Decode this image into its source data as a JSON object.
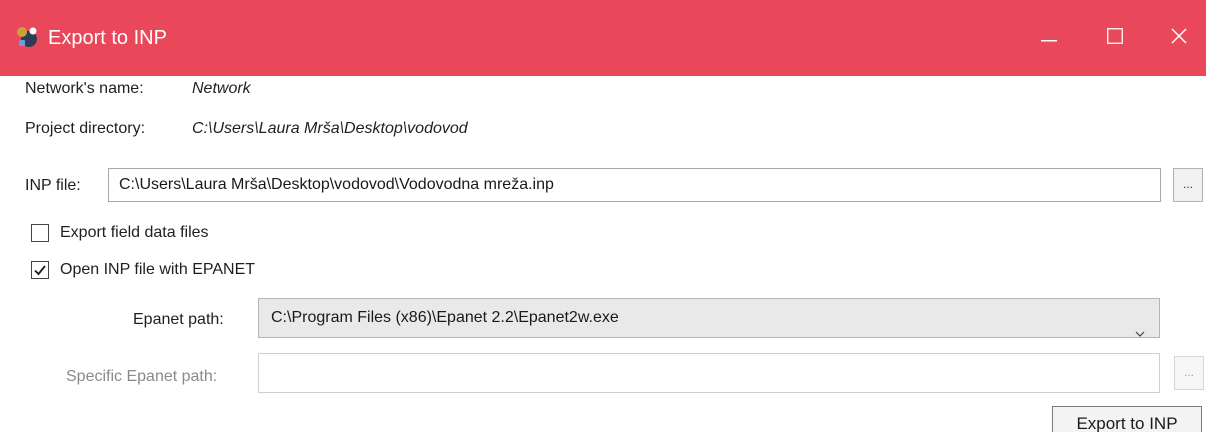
{
  "window": {
    "title": "Export to INP",
    "title_bar_color": "#e8485a",
    "controls": {
      "minimize_icon": "minimize-icon",
      "maximize_icon": "maximize-icon",
      "close_icon": "close-icon"
    }
  },
  "info": {
    "network_name_label": "Network's name:",
    "network_name_value": "Network",
    "project_dir_label": "Project directory:",
    "project_dir_value": "C:\\Users\\Laura Mrša\\Desktop\\vodovod"
  },
  "inp_file": {
    "label": "INP file:",
    "value": "C:\\Users\\Laura Mrša\\Desktop\\vodovod\\Vodovodna mreža.inp",
    "browse_label": "..."
  },
  "options": {
    "export_field_data": {
      "label": "Export field data files",
      "checked": false
    },
    "open_with_epanet": {
      "label": "Open INP file with EPANET",
      "checked": true
    }
  },
  "epanet": {
    "path_label": "Epanet path:",
    "path_value": "C:\\Program Files (x86)\\Epanet 2.2\\Epanet2w.exe",
    "specific_label": "Specific Epanet path:",
    "specific_value": "",
    "specific_browse_label": "..."
  },
  "actions": {
    "export_label": "Export to INP"
  }
}
